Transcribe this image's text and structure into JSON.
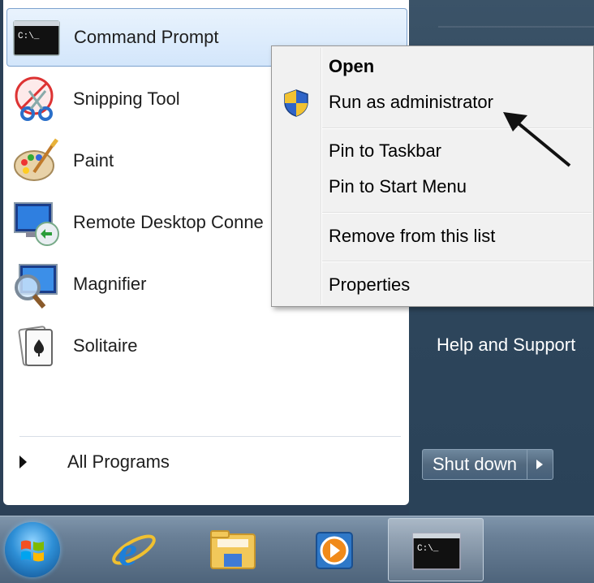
{
  "programs": [
    {
      "label": "Command Prompt",
      "icon": "command-prompt-icon"
    },
    {
      "label": "Snipping Tool",
      "icon": "snipping-tool-icon"
    },
    {
      "label": "Paint",
      "icon": "paint-icon"
    },
    {
      "label": "Remote Desktop Conne",
      "icon": "remote-desktop-icon"
    },
    {
      "label": "Magnifier",
      "icon": "magnifier-icon"
    },
    {
      "label": "Solitaire",
      "icon": "solitaire-icon"
    }
  ],
  "all_programs_label": "All Programs",
  "right_pane": {
    "help_label": "Help and Support",
    "shutdown_label": "Shut down"
  },
  "context_menu": {
    "open": "Open",
    "run_as_admin": "Run as administrator",
    "pin_taskbar": "Pin to Taskbar",
    "pin_start": "Pin to Start Menu",
    "remove": "Remove from this list",
    "properties": "Properties"
  },
  "cmd_icon_text": "C:\\_",
  "taskbar_icons": [
    "start-orb-icon",
    "internet-explorer-icon",
    "file-explorer-icon",
    "media-player-icon",
    "command-prompt-icon"
  ],
  "colors": {
    "selection_border": "#7da2ce",
    "taskbar": "#6a8097",
    "right_pane": "#2f475d"
  }
}
